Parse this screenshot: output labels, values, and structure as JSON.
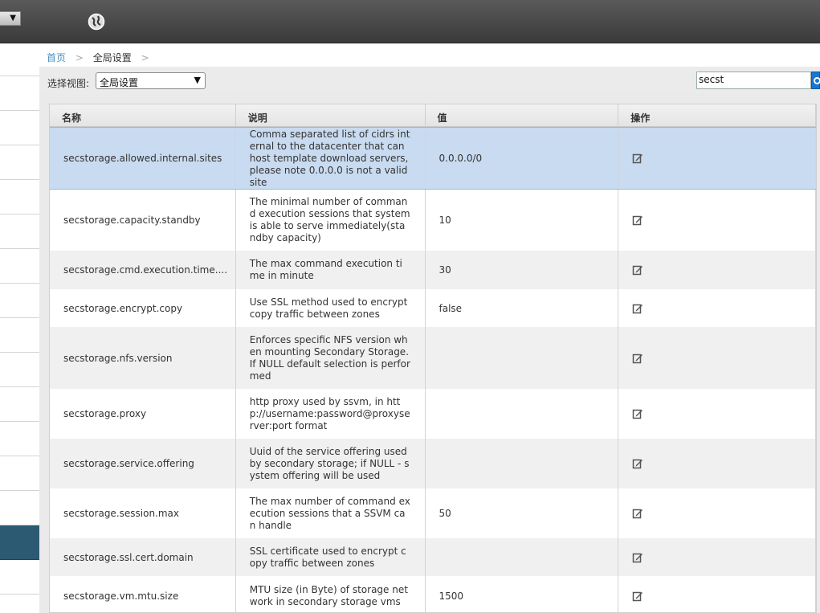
{
  "breadcrumb": {
    "home": "首页",
    "separator": ">",
    "current": "全局设置"
  },
  "toolbar": {
    "view_label": "选择视图:",
    "view_value": "全局设置",
    "search_value": "secst"
  },
  "grid": {
    "headers": [
      "名称",
      "说明",
      "值",
      "操作"
    ],
    "rows": [
      {
        "name": "secstorage.allowed.internal.sites",
        "desc": "Comma separated list of cidrs internal to the datacenter that can host template download servers, please note 0.0.0.0 is not a valid site",
        "value": "0.0.0.0/0"
      },
      {
        "name": "secstorage.capacity.standby",
        "desc": "The minimal number of command execution sessions that system is able to serve immediately(standby capacity)",
        "value": "10"
      },
      {
        "name": "secstorage.cmd.execution.time....",
        "desc": "The max command execution time in minute",
        "value": "30"
      },
      {
        "name": "secstorage.encrypt.copy",
        "desc": "Use SSL method used to encrypt copy traffic between zones",
        "value": "false"
      },
      {
        "name": "secstorage.nfs.version",
        "desc": "Enforces specific NFS version when mounting Secondary Storage. If NULL default selection is performed",
        "value": ""
      },
      {
        "name": "secstorage.proxy",
        "desc": "http proxy used by ssvm, in http://username:password@proxyserver:port format",
        "value": ""
      },
      {
        "name": "secstorage.service.offering",
        "desc": "Uuid of the service offering used by secondary storage; if NULL - system offering will be used",
        "value": ""
      },
      {
        "name": "secstorage.session.max",
        "desc": "The max number of command execution sessions that a SSVM can handle",
        "value": "50"
      },
      {
        "name": "secstorage.ssl.cert.domain",
        "desc": "SSL certificate used to encrypt copy traffic between zones",
        "value": ""
      },
      {
        "name": "secstorage.vm.mtu.size",
        "desc": "MTU size (in Byte) of storage network in secondary storage vms",
        "value": "1500"
      }
    ]
  }
}
